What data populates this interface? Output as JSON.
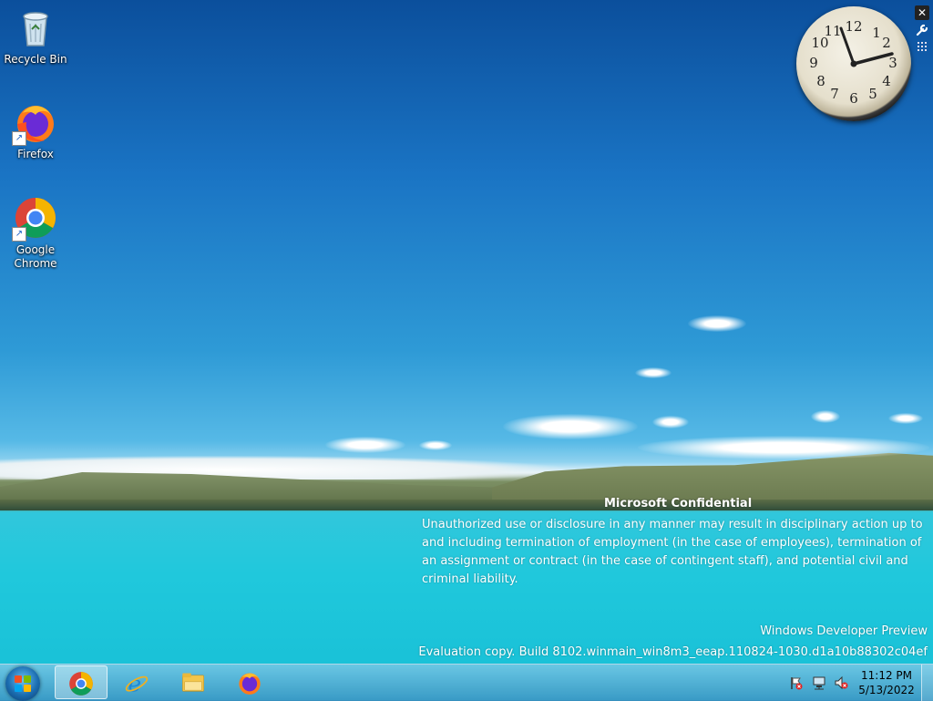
{
  "desktop": {
    "icons": [
      {
        "label": "Recycle Bin"
      },
      {
        "label": "Firefox"
      },
      {
        "label": "Google Chrome"
      }
    ]
  },
  "clock_gadget": {
    "numbers": [
      "12",
      "1",
      "2",
      "3",
      "4",
      "5",
      "6",
      "7",
      "8",
      "9",
      "10",
      "11"
    ]
  },
  "gadget_controls": {
    "close_label": "✕",
    "options_label": "🔧",
    "drag_label": "⋮⋮"
  },
  "watermark": {
    "confidential_title": "Microsoft Confidential",
    "confidential_body": "Unauthorized use or disclosure in any manner may result in disciplinary action up to and including termination of employment (in the case of employees), termination of an assignment or contract (in the case of contingent staff), and potential civil and criminal liability.",
    "edition": "Windows Developer Preview",
    "build": "Evaluation copy. Build 8102.winmain_win8m3_eeap.110824-1030.d1a10b88302c04ef"
  },
  "taskbar": {
    "pinned": [
      {
        "icon": "chrome-icon",
        "active": true
      },
      {
        "icon": "internet-explorer-icon",
        "active": false
      },
      {
        "icon": "file-explorer-icon",
        "active": false
      },
      {
        "icon": "firefox-icon",
        "active": false
      }
    ],
    "tray_icons": [
      "action-center-flag-icon",
      "network-icon",
      "volume-muted-icon"
    ],
    "time": "11:12 PM",
    "date": "5/13/2022"
  },
  "colors": {
    "sky_top": "#0b4f9c",
    "lake": "#20c8dc",
    "taskbar": "#4ea9d1"
  }
}
